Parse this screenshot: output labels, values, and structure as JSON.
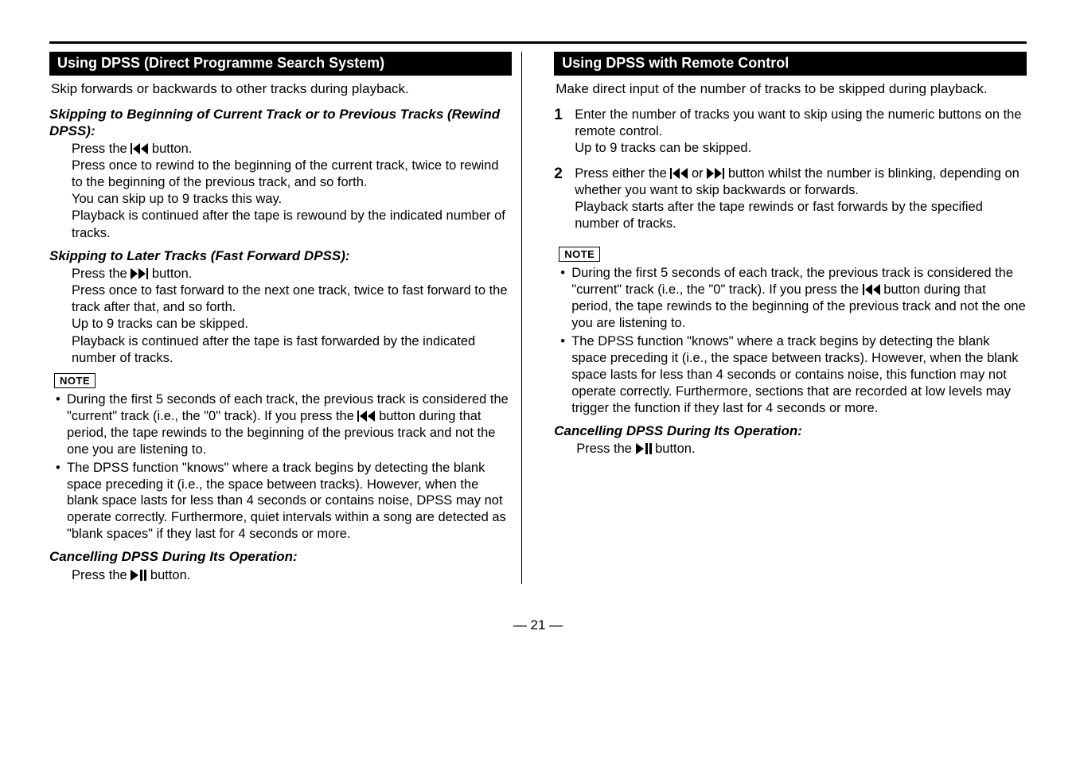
{
  "left": {
    "bar": "Using DPSS (Direct Programme Search System)",
    "lead": "Skip forwards or backwards to other tracks during playback.",
    "s1_h": "Skipping to Beginning of Current Track or to Previous Tracks (Rewind DPSS):",
    "s1_p1a": "Press the ",
    "s1_p1b": " button.",
    "s1_p2": "Press once to rewind to the beginning of the current track, twice to rewind to the beginning of the previous track, and so forth.",
    "s1_p3": "You can skip up to 9 tracks this way.",
    "s1_p4": "Playback is continued after the tape is rewound by the indicated number of tracks.",
    "s2_h": "Skipping to Later Tracks (Fast Forward DPSS):",
    "s2_p1a": "Press the ",
    "s2_p1b": " button.",
    "s2_p2": "Press once to fast forward to the next one track, twice to fast forward to the track after that, and so forth.",
    "s2_p3": "Up to 9 tracks can be skipped.",
    "s2_p4": "Playback is continued after the tape is fast forwarded by the indicated number of tracks.",
    "note_label": "NOTE",
    "n1a": "During the first 5 seconds of each track, the previous track is considered the \"current\" track (i.e., the \"0\" track). If you press the ",
    "n1b": " button during that period, the tape rewinds to the beginning of the previous track and not the one you are listening to.",
    "n2": "The DPSS function \"knows\" where a track begins by detecting the blank space preceding it (i.e., the space between tracks). However, when the blank space lasts for less than 4 seconds or contains noise, DPSS may not operate correctly. Furthermore, quiet intervals within a song are detected as \"blank spaces\" if they last for 4 seconds or more.",
    "cancel_h": "Cancelling DPSS During Its Operation:",
    "cancel_a": "Press the ",
    "cancel_b": " button."
  },
  "right": {
    "bar": "Using DPSS with Remote Control",
    "lead": "Make direct input of the number of tracks to be skipped during playback.",
    "step1_num": "1",
    "step1_t1": "Enter the number of tracks you want to skip using the numeric buttons on the remote control.",
    "step1_t2": "Up to 9 tracks can be skipped.",
    "step2_num": "2",
    "step2_t1a": "Press either the ",
    "step2_t1b": " or ",
    "step2_t1c": " button whilst the number is blinking, depending on whether you want to skip backwards or forwards.",
    "step2_t2": "Playback starts after the tape rewinds or fast forwards by the specified number of tracks.",
    "note_label": "NOTE",
    "n1a": "During the first 5 seconds of each track, the previous track is considered the \"current\" track (i.e., the \"0\" track). If you press the ",
    "n1b": " button during that period, the tape rewinds to the beginning of the previous track and not the one you are listening to.",
    "n2": "The DPSS function \"knows\" where a track begins by detecting the blank space preceding it (i.e., the space between tracks). However, when the blank space lasts for less than 4 seconds or contains noise, this function may not operate correctly. Furthermore, sections that are recorded at low levels may trigger the function if they last for 4 seconds or more.",
    "cancel_h": "Cancelling DPSS During Its Operation:",
    "cancel_a": "Press the ",
    "cancel_b": " button."
  },
  "page_number": "— 21 —"
}
